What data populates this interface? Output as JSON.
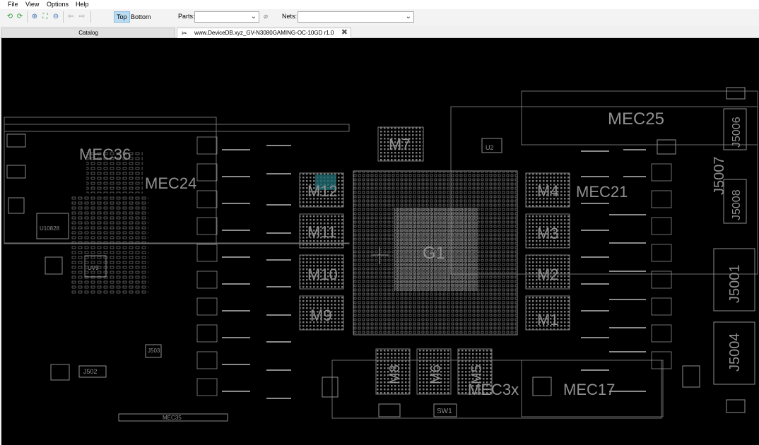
{
  "menu": {
    "file": "File",
    "view": "View",
    "options": "Options",
    "help": "Help"
  },
  "toolbar": {
    "top_label": "Top",
    "bottom_label": "Bottom",
    "parts_label": "Parts:",
    "parts_value": "",
    "nets_label": "Nets:",
    "nets_value": ""
  },
  "tabs": {
    "catalog": "Catalog",
    "document": "www.DeviceDB.xyz_GV-N3080GAMING-OC-10GD r1.0"
  },
  "board": {
    "labels": {
      "mec25": "MEC25",
      "j5006": "J5006",
      "j5007": "J5007",
      "j5008": "J5008",
      "j5001": "J5001",
      "j5004": "J5004",
      "mec21": "MEC21",
      "mec17": "MEC17",
      "mec36": "MEC36",
      "mec24": "MEC24",
      "mec35": "MEC35",
      "mec3x": "MEC3x",
      "m1": "M1",
      "m2": "M2",
      "m3": "M3",
      "m4": "M4",
      "m5": "M5",
      "m6": "M6",
      "m7": "M7",
      "m8": "M8",
      "m9": "M9",
      "m10": "M10",
      "m11": "M11",
      "m12": "M12",
      "g1": "G1",
      "u2": "U2",
      "u9": "UV9",
      "u10828": "U10828",
      "sw1": "SW1",
      "j502": "J502",
      "j503": "J503"
    }
  }
}
